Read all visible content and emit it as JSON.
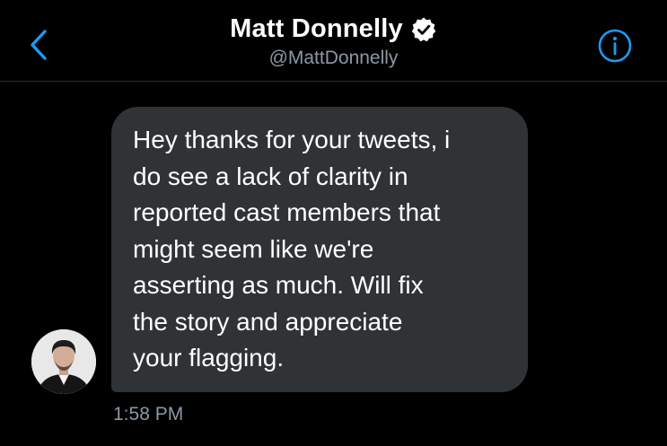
{
  "colors": {
    "background": "#000000",
    "accent": "#1d9bf0",
    "bubble": "#2f3336",
    "secondary_text": "#8b98a5"
  },
  "header": {
    "back_icon": "chevron-left-icon",
    "name": "Matt Donnelly",
    "verified_icon": "verified-badge-icon",
    "handle": "@MattDonnelly",
    "info_icon": "info-icon"
  },
  "message": {
    "lines": [
      "Hey thanks for your tweets, i",
      "do see a lack of clarity in",
      "reported cast members that",
      "might seem like we're",
      "asserting as much. Will fix",
      "the story and appreciate",
      "your flagging."
    ],
    "time": "1:58 PM"
  }
}
